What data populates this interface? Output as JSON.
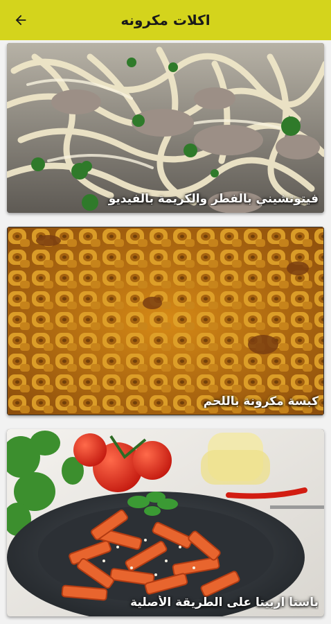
{
  "header": {
    "title": "اكلات مكرونه",
    "back_icon": "arrow-left-icon"
  },
  "colors": {
    "header_bg": "#d4d41c",
    "caption_text": "#ffffff"
  },
  "recipes": [
    {
      "title": "فيتوتشيني بالفطر والكريمة بالفيديو",
      "image": "fettuccine-mushroom-cream-photo"
    },
    {
      "title": "كبسة مكرونة باللحم",
      "image": "macaroni-kabsa-meat-photo"
    },
    {
      "title": "باستا اربيتا على الطريقة الأصلية",
      "image": "penne-arrabbiata-photo"
    }
  ]
}
